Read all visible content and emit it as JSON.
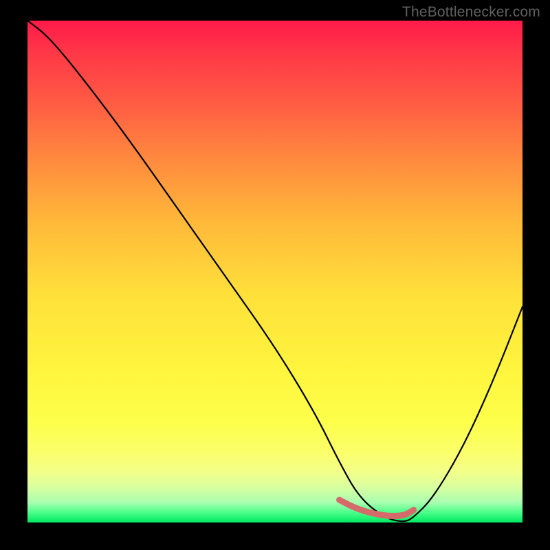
{
  "attribution": "TheBottlenecker.com",
  "chart_data": {
    "type": "line",
    "title": "",
    "xlabel": "",
    "ylabel": "",
    "xlim": [
      0,
      100
    ],
    "ylim": [
      0,
      100
    ],
    "series": [
      {
        "name": "main-curve",
        "x": [
          0,
          4,
          10,
          20,
          30,
          40,
          50,
          58,
          63,
          67,
          72,
          76,
          78,
          82,
          88,
          94,
          100
        ],
        "values": [
          100,
          97,
          90,
          77,
          63,
          49,
          35,
          22,
          12,
          5,
          1,
          0,
          1,
          5,
          15,
          28,
          43
        ]
      },
      {
        "name": "highlight-segment",
        "x": [
          63,
          67,
          72,
          76,
          78
        ],
        "values": [
          4.5,
          2.5,
          1.3,
          1.3,
          2.5
        ]
      }
    ]
  }
}
